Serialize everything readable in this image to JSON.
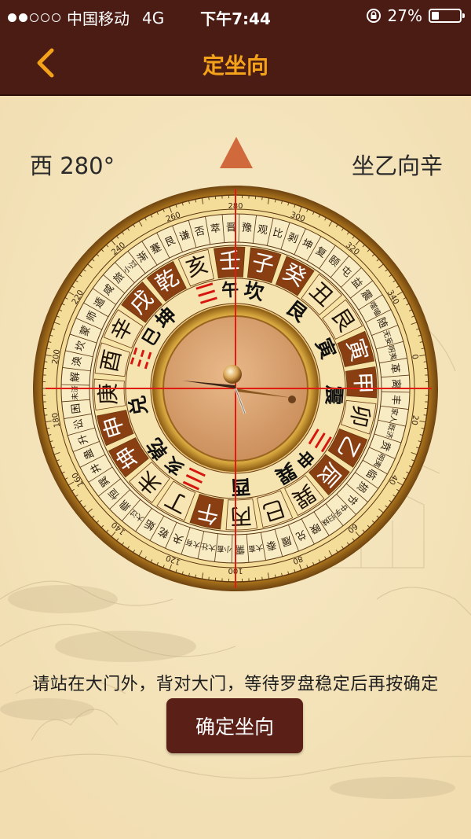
{
  "status_bar": {
    "carrier": "中国移动",
    "network": "4G",
    "time": "下午7:44",
    "battery": "27%",
    "battery_level": 0.27
  },
  "nav": {
    "title": "定坐向",
    "back_icon": "chevron-left-icon"
  },
  "compass_readout": {
    "direction": "西 280°",
    "orientation": "坐乙向辛"
  },
  "compass": {
    "heading_degrees": 280,
    "trigram_ring": [
      {
        "char": "震",
        "red": false
      },
      {
        "char": "☰",
        "red": true,
        "label": "申"
      },
      {
        "char": "巽",
        "red": false
      },
      {
        "char": "酉",
        "red": false
      },
      {
        "char": "☰",
        "red": true,
        "label": "亥"
      },
      {
        "char": "乾",
        "red": false
      },
      {
        "char": "兑",
        "red": false
      },
      {
        "char": "☷",
        "red": true,
        "label": "巳"
      },
      {
        "char": "坤",
        "red": false
      },
      {
        "char": "☰",
        "red": true,
        "label": "午"
      },
      {
        "char": "坎",
        "red": false
      },
      {
        "char": "艮",
        "red": false
      },
      {
        "char": "寅",
        "red": false
      }
    ],
    "mountain_ring": [
      {
        "char": "甲",
        "dark": true
      },
      {
        "char": "卯",
        "dark": false
      },
      {
        "char": "乙",
        "dark": true
      },
      {
        "char": "辰",
        "dark": true
      },
      {
        "char": "巽",
        "dark": false
      },
      {
        "char": "巳",
        "dark": false
      },
      {
        "char": "丙",
        "dark": false
      },
      {
        "char": "午",
        "dark": true
      },
      {
        "char": "丁",
        "dark": false
      },
      {
        "char": "未",
        "dark": false
      },
      {
        "char": "坤",
        "dark": true
      },
      {
        "char": "申",
        "dark": true
      },
      {
        "char": "庚",
        "dark": false
      },
      {
        "char": "酉",
        "dark": false
      },
      {
        "char": "辛",
        "dark": false
      },
      {
        "char": "戌",
        "dark": true
      },
      {
        "char": "乾",
        "dark": true
      },
      {
        "char": "亥",
        "dark": false
      },
      {
        "char": "壬",
        "dark": true
      },
      {
        "char": "子",
        "dark": true
      },
      {
        "char": "癸",
        "dark": true
      },
      {
        "char": "丑",
        "dark": false
      },
      {
        "char": "艮",
        "dark": false
      },
      {
        "char": "寅",
        "dark": true
      }
    ],
    "hexagram_ring": [
      "革",
      "离",
      "丰",
      "家人",
      "既济",
      "贲",
      "明夷",
      "临",
      "损",
      "节",
      "中孚",
      "归妹",
      "睽",
      "兑",
      "履",
      "泰",
      "大畜",
      "需",
      "小畜",
      "大壮",
      "大有",
      "夬",
      "乾",
      "姤",
      "大过",
      "鼎",
      "恒",
      "巽",
      "井",
      "蛊",
      "升",
      "讼",
      "困",
      "未济",
      "解",
      "涣",
      "坎",
      "蒙",
      "师",
      "遁",
      "咸",
      "旅",
      "小过",
      "渐",
      "蹇",
      "艮",
      "谦",
      "否",
      "萃",
      "晋",
      "豫",
      "观",
      "比",
      "剥",
      "坤",
      "复",
      "颐",
      "屯",
      "益",
      "震",
      "噬嗑",
      "随",
      "无妄",
      "明夷"
    ],
    "degree_labels": [
      "80",
      "100",
      "120",
      "140",
      "160",
      "180",
      "200",
      "220",
      "240",
      "260",
      "280",
      "300",
      "320",
      "340",
      "0",
      "20",
      "40",
      "60"
    ]
  },
  "instruction": "请站在大门外，背对大门，等待罗盘稳定后再按确定",
  "confirm_button": "确定坐向"
}
